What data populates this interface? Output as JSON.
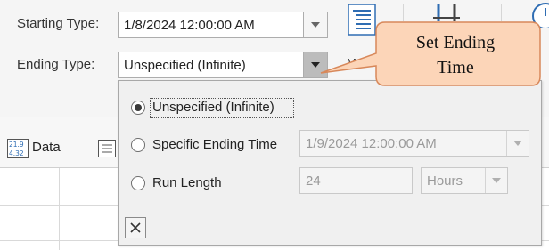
{
  "ribbon": {
    "starting_type_label": "Starting Type:",
    "starting_type_value": "1/8/2024 12:00:00 AM",
    "ending_type_label": "Ending Type:",
    "ending_type_value": "Unspecified (Infinite)",
    "partial_button_label": "M",
    "icons": [
      "view-list-icon",
      "bar-chart-icon",
      "clock-icon"
    ]
  },
  "toolbar": {
    "data_tab_label": "Data",
    "data_tab_icon_text": [
      "21.9",
      "4.32"
    ]
  },
  "popup": {
    "options": [
      {
        "label": "Unspecified (Infinite)",
        "selected": true
      },
      {
        "label": "Specific Ending Time",
        "selected": false
      },
      {
        "label": "Run Length",
        "selected": false
      }
    ],
    "specific_ending_time_value": "1/9/2024 12:00:00 AM",
    "run_length_value": "24",
    "run_length_unit": "Hours"
  },
  "callout": {
    "text_line1": "Set Ending",
    "text_line2": "Time",
    "fill_color": "#fcd5b8",
    "border_color": "#d8885a"
  }
}
